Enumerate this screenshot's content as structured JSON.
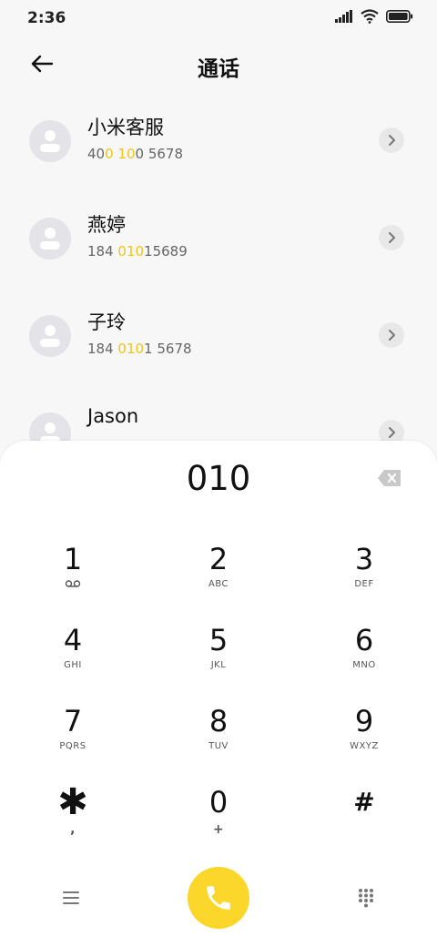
{
  "status": {
    "time": "2:36"
  },
  "header": {
    "title": "通话"
  },
  "contacts": [
    {
      "name": "小米客服",
      "number_parts": [
        {
          "t": "40",
          "hl": false
        },
        {
          "t": "0",
          "hl": true
        },
        {
          "t": " ",
          "hl": false
        },
        {
          "t": "10",
          "hl": true
        },
        {
          "t": "0 5678",
          "hl": false
        }
      ]
    },
    {
      "name": "燕婷",
      "number_parts": [
        {
          "t": "184 ",
          "hl": false
        },
        {
          "t": "010",
          "hl": true
        },
        {
          "t": "15689",
          "hl": false
        }
      ]
    },
    {
      "name": "子玲",
      "number_parts": [
        {
          "t": "184 ",
          "hl": false
        },
        {
          "t": "010",
          "hl": true
        },
        {
          "t": "1 5678",
          "hl": false
        }
      ]
    },
    {
      "name": "Jason",
      "number_parts": []
    }
  ],
  "dialpad": {
    "display": "010",
    "keys": [
      {
        "digit": "1",
        "letters": "",
        "sub_icon": "voicemail-icon"
      },
      {
        "digit": "2",
        "letters": "ABC"
      },
      {
        "digit": "3",
        "letters": "DEF"
      },
      {
        "digit": "4",
        "letters": "GHI"
      },
      {
        "digit": "5",
        "letters": "JKL"
      },
      {
        "digit": "6",
        "letters": "MNO"
      },
      {
        "digit": "7",
        "letters": "PQRS"
      },
      {
        "digit": "8",
        "letters": "TUV"
      },
      {
        "digit": "9",
        "letters": "WXYZ"
      },
      {
        "digit": "✱",
        "letters": ","
      },
      {
        "digit": "0",
        "letters": "+"
      },
      {
        "digit": "#",
        "letters": ""
      }
    ]
  },
  "icons": {
    "back": "arrow-left-icon",
    "chevron": "chevron-right-icon",
    "backspace": "backspace-icon",
    "menu": "menu-icon",
    "call": "phone-icon",
    "keypad": "dialpad-icon"
  },
  "colors": {
    "accent": "#fbd72b",
    "highlight": "#f0c419"
  }
}
